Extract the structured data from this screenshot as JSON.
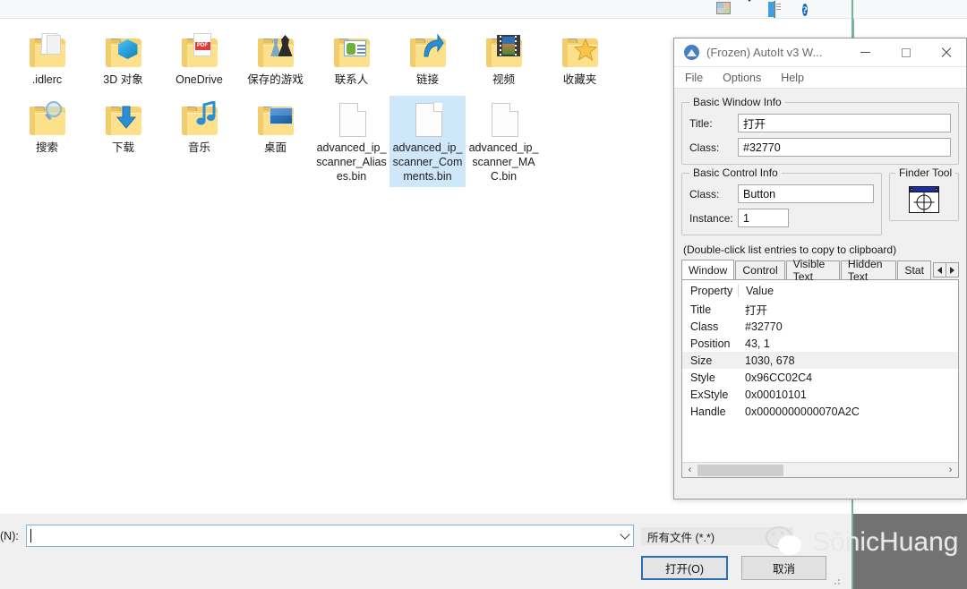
{
  "explorer": {
    "toolbar": {
      "view_icon": "view-grid-icon",
      "caret_icon": "chevron-down-icon",
      "pane_icon": "preview-pane-icon",
      "help_icon": "help-icon"
    },
    "items": [
      {
        "label": ".idlerc",
        "type": "folder",
        "overlay": "paper",
        "selected": false
      },
      {
        "label": "3D 对象",
        "type": "folder",
        "overlay": "cube",
        "selected": false
      },
      {
        "label": "OneDrive",
        "type": "folder",
        "overlay": "pdf",
        "selected": false
      },
      {
        "label": "保存的游戏",
        "type": "folder",
        "overlay": "chess",
        "selected": false
      },
      {
        "label": "联系人",
        "type": "folder",
        "overlay": "contact",
        "selected": false
      },
      {
        "label": "链接",
        "type": "folder",
        "overlay": "arrow",
        "selected": false
      },
      {
        "label": "视频",
        "type": "folder",
        "overlay": "film",
        "selected": false
      },
      {
        "label": "收藏夹",
        "type": "folder",
        "overlay": "star",
        "selected": false
      },
      {
        "label": "搜索",
        "type": "folder",
        "overlay": "search",
        "selected": false
      },
      {
        "label": "下载",
        "type": "folder",
        "overlay": "down",
        "selected": false
      },
      {
        "label": "音乐",
        "type": "folder",
        "overlay": "music",
        "selected": false
      },
      {
        "label": "桌面",
        "type": "folder",
        "overlay": "desktop",
        "selected": false
      },
      {
        "label": "advanced_ip_scanner_Aliases.bin",
        "type": "file",
        "overlay": "",
        "selected": false
      },
      {
        "label": "advanced_ip_scanner_Comments.bin",
        "type": "file",
        "overlay": "",
        "selected": true
      },
      {
        "label": "advanced_ip_scanner_MAC.bin",
        "type": "file",
        "overlay": "",
        "selected": false
      }
    ],
    "filename_label": "(N):",
    "filename_value": "",
    "filetype_value": "所有文件 (*.*)",
    "open_button": "打开(O)",
    "cancel_button": "取消"
  },
  "watermark": {
    "text": "SŏnicHuang",
    "logo": "wechat-logo"
  },
  "autoit": {
    "title": "(Frozen) AutoIt v3 W...",
    "window_buttons": {
      "minimize": "minimize-icon",
      "maximize": "maximize-icon",
      "close": "close-icon"
    },
    "menu": [
      "File",
      "Options",
      "Help"
    ],
    "basic_window_info": {
      "legend": "Basic Window Info",
      "title_label": "Title:",
      "title_value": "打开",
      "class_label": "Class:",
      "class_value": "#32770"
    },
    "basic_control_info": {
      "legend": "Basic Control Info",
      "class_label": "Class:",
      "class_value": "Button",
      "instance_label": "Instance:",
      "instance_value": "1"
    },
    "finder_tool": {
      "legend": "Finder Tool",
      "icon": "finder-target-icon"
    },
    "hint": "(Double-click list entries to copy to clipboard)",
    "tabs": [
      {
        "label": "Window",
        "active": true
      },
      {
        "label": "Control",
        "active": false
      },
      {
        "label": "Visible Text",
        "active": false
      },
      {
        "label": "Hidden Text",
        "active": false
      },
      {
        "label": "Stat",
        "active": false
      }
    ],
    "tab_spinner": {
      "left": "scroll-left-icon",
      "right": "scroll-right-icon"
    },
    "list": {
      "headers": [
        "Property",
        "Value"
      ],
      "rows": [
        {
          "property": "Title",
          "value": "打开",
          "highlight": false
        },
        {
          "property": "Class",
          "value": "#32770",
          "highlight": false
        },
        {
          "property": "Position",
          "value": "43, 1",
          "highlight": false
        },
        {
          "property": "Size",
          "value": "1030, 678",
          "highlight": true
        },
        {
          "property": "Style",
          "value": "0x96CC02C4",
          "highlight": false
        },
        {
          "property": "ExStyle",
          "value": "0x00010101",
          "highlight": false
        },
        {
          "property": "Handle",
          "value": "0x0000000000070A2C",
          "highlight": false
        }
      ]
    },
    "hscroll": {
      "left": "‹",
      "right": "›"
    }
  },
  "colors": {
    "accent_blue": "#2a6fb5",
    "selection": "#cfe8f9",
    "folder": "#fce08c",
    "green_edge": "#76b39a",
    "desktop_gray": "#727272"
  }
}
